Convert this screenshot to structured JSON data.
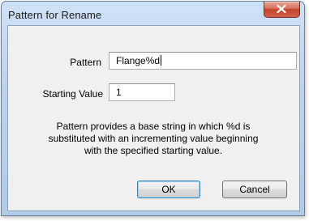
{
  "dialog": {
    "title": "Pattern for Rename",
    "close_symbol": "x"
  },
  "form": {
    "pattern_label": "Pattern",
    "pattern_value": "Flange%d",
    "starting_value_label": "Starting Value",
    "starting_value": "1"
  },
  "description": {
    "line1": "Pattern provides a base string in which %d is",
    "line2": "substituted with an incrementing value beginning",
    "line3": "with the specified starting value."
  },
  "buttons": {
    "ok_label": "OK",
    "cancel_label": "Cancel"
  },
  "colors": {
    "title_bar": "#bcd3ee",
    "close_button": "#c2432a",
    "client_area": "#f0f0f0",
    "default_button_border": "#3c7fb1"
  },
  "icons": {
    "close": "close-icon"
  }
}
